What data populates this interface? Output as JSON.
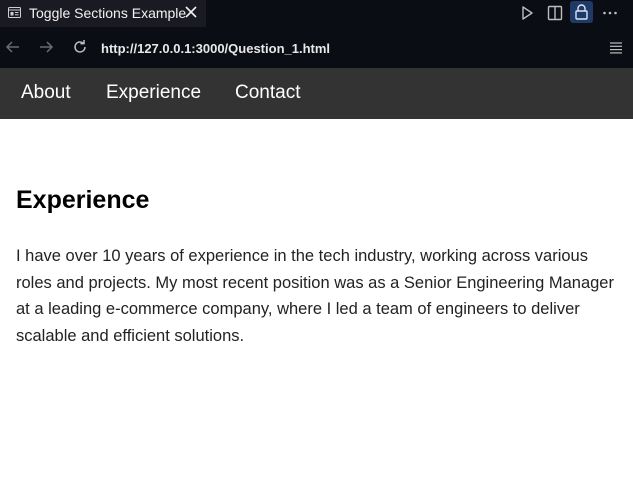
{
  "browser": {
    "tab": {
      "title": "Toggle Sections Example",
      "favicon": "page-icon",
      "close": "close-icon"
    },
    "toolbar_icons": [
      "play-icon",
      "split-view-icon",
      "lock-icon",
      "more-icon"
    ],
    "nav_icons": [
      "back-arrow-icon",
      "forward-arrow-icon",
      "reload-icon"
    ],
    "url": "http://127.0.0.1:3000/Question_1.html",
    "menu_icon": "menu-icon",
    "colors": {
      "chrome_bg": "#0b0d14",
      "tab_bg": "#1a1b22",
      "lock_highlight": "#1f3a66"
    }
  },
  "site_nav": {
    "background": "#333333",
    "links": [
      {
        "label": "About"
      },
      {
        "label": "Experience"
      },
      {
        "label": "Contact"
      }
    ]
  },
  "section": {
    "title": "Experience",
    "body": "I have over 10 years of experience in the tech industry, working across various roles and projects. My most recent position was as a Senior Engineering Manager at a leading e-commerce company, where I led a team of engineers to deliver scalable and efficient solutions."
  }
}
